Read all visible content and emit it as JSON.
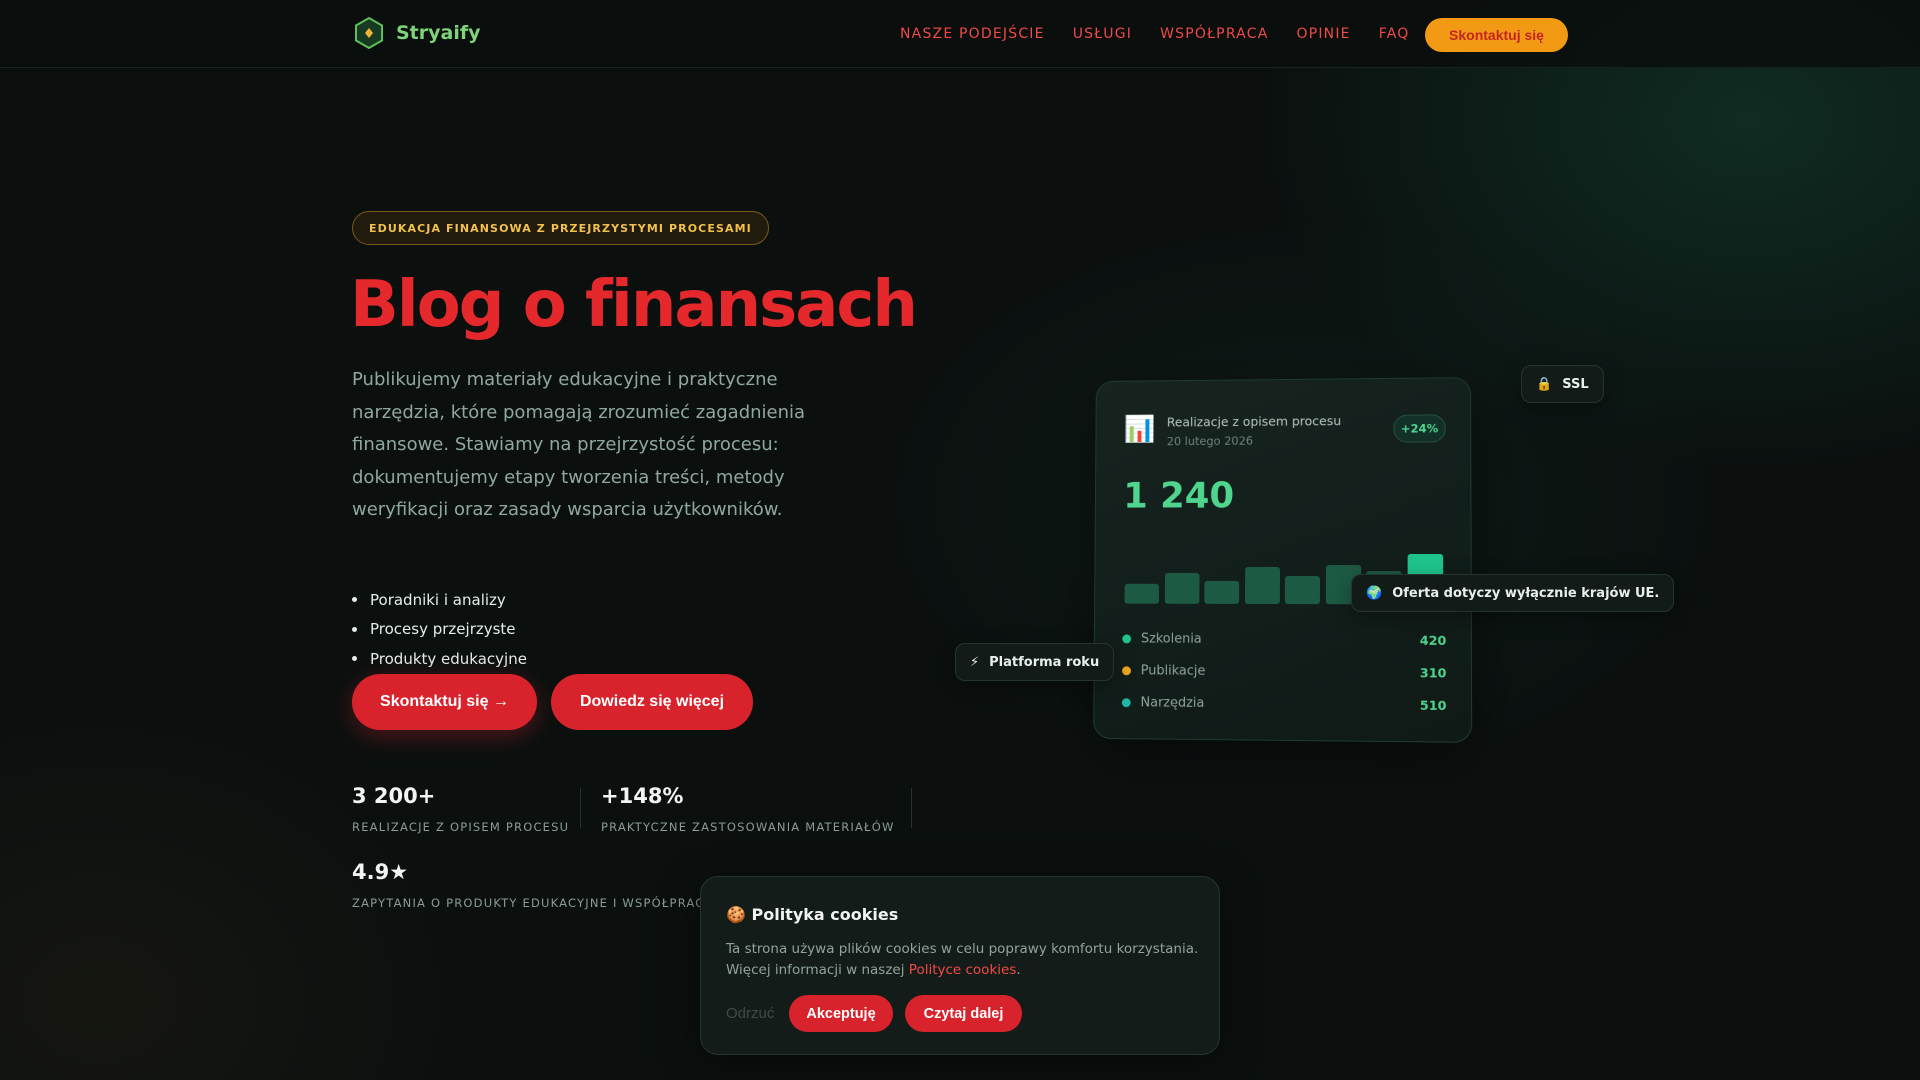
{
  "nav": {
    "logo_text": "Stryaify",
    "links": [
      "NASZE PODEJŚCIE",
      "USŁUGI",
      "WSPÓŁPRACA",
      "OPINIE",
      "FAQ"
    ],
    "cta_label": "Skontaktuj się"
  },
  "hero": {
    "badge": "EDUKACJA FINANSOWA Z PRZEJRZYSTYMI PROCESAMI",
    "title": "Blog o finansach",
    "description": "Publikujemy materiały edukacyjne i praktyczne narzędzia, które pomagają zrozumieć zagadnienia finansowe. Stawiamy na przejrzystość procesu: dokumentujemy etapy tworzenia treści, metody weryfikacji oraz zasady wsparcia użytkowników.",
    "bullets": [
      "Poradniki i analizy",
      "Procesy przejrzyste",
      "Produkty edukacyjne"
    ],
    "primary_button": "Skontaktuj się →",
    "secondary_button": "Dowiedz się więcej"
  },
  "stats": [
    {
      "value": "3 200+",
      "label": "REALIZACJE Z OPISEM PROCESU"
    },
    {
      "value": "+148%",
      "label": "PRAKTYCZNE ZASTOSOWANIA MATERIAŁÓW"
    },
    {
      "value": "4.9★",
      "label": "ZAPYTANIA O PRODUKTY EDUKACYJNE I WSPÓŁPRACĘ"
    }
  ],
  "dashboard": {
    "icon": "bar-chart-emoji",
    "title": "Realizacje z opisem procesu",
    "date": "20 lutego 2026",
    "change": "+24%",
    "total": "1 240",
    "bars": [
      0.33,
      0.52,
      0.38,
      0.62,
      0.46,
      0.65,
      0.55,
      0.83
    ],
    "legend": [
      {
        "label": "Szkolenia",
        "value": "420",
        "color": "#21c38a"
      },
      {
        "label": "Publikacje",
        "value": "310",
        "color": "#f0a81c"
      },
      {
        "label": "Narzędzia",
        "value": "510",
        "color": "#1fb7a6"
      }
    ]
  },
  "chips": {
    "ssl": "SSL",
    "eu": "Oferta dotyczy wyłącznie krajów UE.",
    "platform": "Platforma roku"
  },
  "cookie": {
    "title": "🍪 Polityka cookies",
    "text": "Ta strona używa plików cookies w celu poprawy komfortu korzystania. Więcej informacji w naszej ",
    "link": "Polityce cookies",
    "text_end": ".",
    "decline": "Odrzuć",
    "accept": "Akceptuję",
    "more": "Czytaj dalej"
  },
  "colors": {
    "accent_red": "#d8232d",
    "accent_orange": "#f39a14",
    "accent_green": "#4fd58e",
    "background": "#0b100f"
  }
}
